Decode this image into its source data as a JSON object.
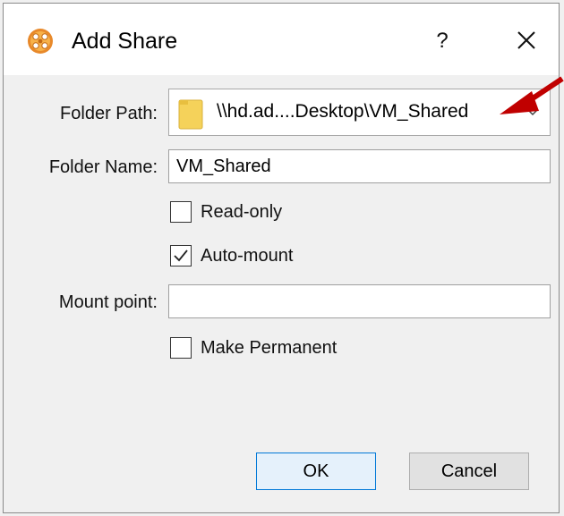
{
  "window": {
    "title": "Add Share",
    "help_label": "?",
    "close_icon": "close-icon",
    "app_icon": "virtualbox-gear-icon"
  },
  "form": {
    "folder_path": {
      "label": "Folder Path:",
      "value": "\\\\hd.ad....Desktop\\VM_Shared",
      "icon": "folder-icon"
    },
    "folder_name": {
      "label": "Folder Name:",
      "value": "VM_Shared"
    },
    "read_only": {
      "label": "Read-only",
      "checked": false
    },
    "auto_mount": {
      "label": "Auto-mount",
      "checked": true
    },
    "mount_point": {
      "label": "Mount point:",
      "value": ""
    },
    "make_permanent": {
      "label": "Make Permanent",
      "checked": false
    }
  },
  "buttons": {
    "ok_label": "OK",
    "cancel_label": "Cancel"
  },
  "colors": {
    "annotation_arrow": "#c00000",
    "ok_border": "#0078d7",
    "folder": "#f5d25a"
  }
}
